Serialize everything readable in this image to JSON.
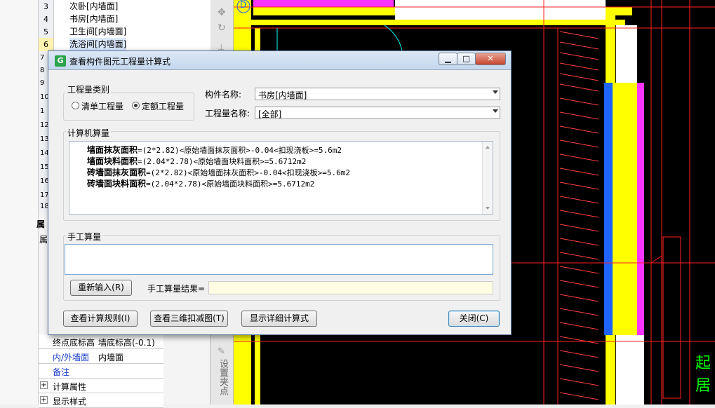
{
  "left_list": [
    {
      "num": "3",
      "label": "次卧[内墙面]"
    },
    {
      "num": "4",
      "label": "书房[内墙面]"
    },
    {
      "num": "5",
      "label": "卫生间[内墙面]"
    },
    {
      "num": "6",
      "label": "洗浴间[内墙面]"
    }
  ],
  "left_rownums": [
    "7",
    "8",
    "9",
    "10",
    "1",
    "12",
    "13",
    "14",
    "15",
    "16",
    "17",
    "18"
  ],
  "props_tab": "属",
  "props_tab2": "属",
  "props": [
    {
      "key": "终点底标高",
      "value": "墙底标高(-0.1)"
    },
    {
      "key": "内/外墙面",
      "value": "内墙面"
    },
    {
      "key": "备注",
      "value": ""
    }
  ],
  "tree": [
    {
      "toggle": "+",
      "label": "计算属性"
    },
    {
      "toggle": "+",
      "label": "显示样式"
    }
  ],
  "toolbar_side_label": "设置夹点",
  "cad": {
    "circle_label": "D",
    "green_text": "起居"
  },
  "dialog": {
    "title": "查看构件图元工程量计算式",
    "app_icon": "G",
    "win_buttons": {
      "minimize": "▁",
      "maximize": "□",
      "close": "✕"
    },
    "category_label": "工程量类别",
    "radio_options": [
      {
        "label": "清单工程量",
        "selected": false
      },
      {
        "label": "定额工程量",
        "selected": true
      }
    ],
    "component_name_label": "构件名称:",
    "component_name_value": "书房[内墙面]",
    "quantity_name_label": "工程量名称:",
    "quantity_name_value": "[全部]",
    "computer_calc_label": "计算机算量",
    "formulas": [
      {
        "name": "墙面抹灰面积",
        "expr": "=(2*2.82)<原始墙面抹灰面积>-0.04<扣现浇板>=5.6m2"
      },
      {
        "name": "墙面块料面积",
        "expr": "=(2.04*2.78)<原始墙面块料面积>=5.6712m2"
      },
      {
        "name": "砖墙面抹灰面积",
        "expr": "=(2*2.82)<原始墙面抹灰面积>-0.04<扣现浇板>=5.6m2"
      },
      {
        "name": "砖墙面块料面积",
        "expr": "=(2.04*2.78)<原始墙面块料面积>=5.6712m2"
      }
    ],
    "manual_calc_label": "手工算量",
    "reinput_button": "重新输入(R)",
    "manual_result_label": "手工算量结果=",
    "manual_result_value": "",
    "buttons": {
      "view_rules": "查看计算规则(I)",
      "view_3d": "查看三维扣减图(T)",
      "show_detail": "显示详细计算式",
      "close": "关闭(C)"
    }
  },
  "colors": {
    "cad_yellow": "#ffff00",
    "cad_magenta": "#ff33ff",
    "cad_blue": "#1f63ff",
    "cad_red": "#ff2020",
    "cad_green": "#00ff00"
  }
}
